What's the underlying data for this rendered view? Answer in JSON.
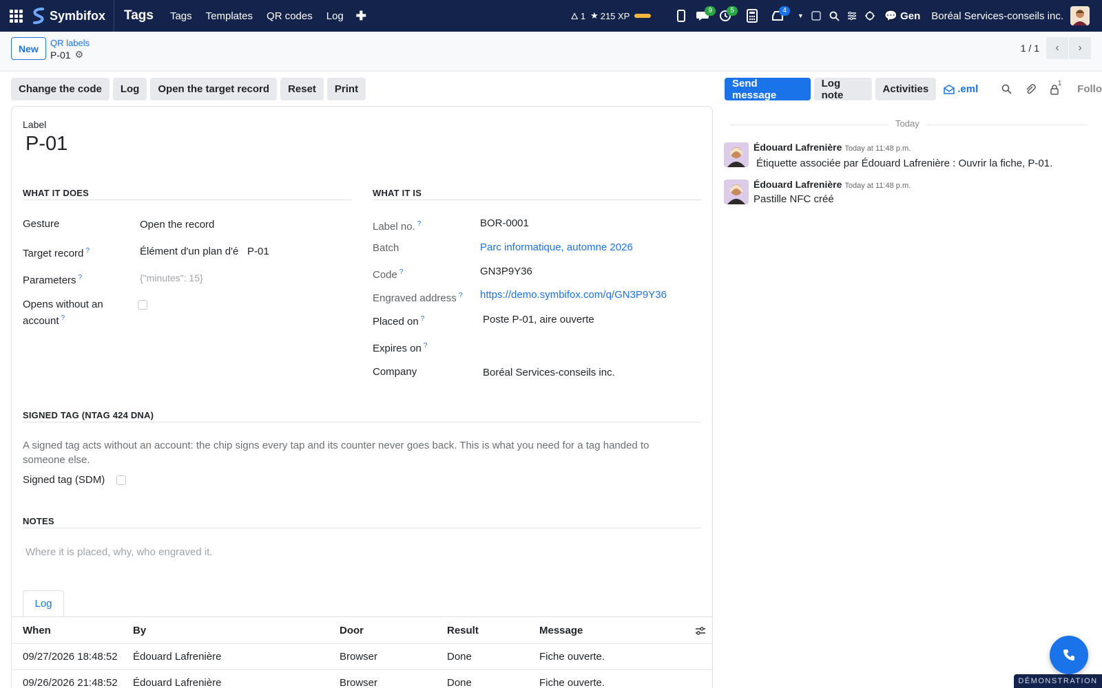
{
  "nav": {
    "brand": "Symbifox",
    "app_title": "Tags",
    "menu": [
      "Tags",
      "Templates",
      "QR codes",
      "Log"
    ],
    "streak": "1",
    "xp": "215 XP",
    "badges": {
      "messages": "9",
      "activities": "5",
      "inbox": "4"
    },
    "gen_label": "Gen",
    "company": "Boréal Services-conseils inc."
  },
  "control": {
    "new_label": "New",
    "breadcrumb_parent": "QR labels",
    "breadcrumb_current": "P-01",
    "pager": "1 / 1"
  },
  "status_buttons": [
    "Change the code",
    "Log",
    "Open the target record",
    "Reset",
    "Print"
  ],
  "form": {
    "label_caption": "Label",
    "label_value": "P-01",
    "what_it_does": {
      "title": "WHAT IT DOES",
      "gesture_label": "Gesture",
      "gesture_value": "Open the record",
      "target_label": "Target record",
      "target_model": "Élément d'un plan d'é",
      "target_value": "P-01",
      "params_label": "Parameters",
      "params_placeholder": "{\"minutes\": 15}",
      "opens_label": "Opens without an account"
    },
    "what_it_is": {
      "title": "WHAT IT IS",
      "label_no_label": "Label no.",
      "label_no_value": "BOR-0001",
      "batch_label": "Batch",
      "batch_value": "Parc informatique, automne 2026",
      "code_label": "Code",
      "code_value": "GN3P9Y36",
      "address_label": "Engraved address",
      "address_value": "https://demo.symbifox.com/q/GN3P9Y36",
      "placed_label": "Placed on",
      "placed_value": "Poste P-01, aire ouverte",
      "expires_label": "Expires on",
      "company_label": "Company",
      "company_value": "Boréal Services-conseils inc."
    },
    "signed": {
      "title": "SIGNED TAG (NTAG 424 DNA)",
      "description": "A signed tag acts without an account: the chip signs every tap and its counter never goes back. This is what you need for a tag handed to someone else.",
      "sdm_label": "Signed tag (SDM)"
    },
    "notes": {
      "title": "NOTES",
      "placeholder": "Where it is placed, why, who engraved it."
    },
    "tab_label": "Log",
    "log": {
      "headers": [
        "When",
        "By",
        "Door",
        "Result",
        "Message"
      ],
      "rows": [
        [
          "09/27/2026 18:48:52",
          "Édouard Lafrenière",
          "Browser",
          "Done",
          "Fiche ouverte."
        ],
        [
          "09/26/2026 21:48:52",
          "Édouard Lafrenière",
          "Browser",
          "Done",
          "Fiche ouverte."
        ]
      ]
    }
  },
  "chatter": {
    "send_message": "Send message",
    "log_note": "Log note",
    "activities": "Activities",
    "eml": ".eml",
    "followers_count": "1",
    "follow": "Follo",
    "today": "Today",
    "messages": [
      {
        "author": "Édouard Lafrenière",
        "time": "Today at 11:48 p.m.",
        "body": "Étiquette associée par Édouard Lafrenière : Ouvrir la fiche, P-01."
      },
      {
        "author": "Édouard Lafrenière",
        "time": "Today at 11:48 p.m.",
        "body": "Pastille NFC créé"
      }
    ]
  },
  "demo_label": "DÉMONSTRATION",
  "colors": {
    "navbar": "#14234b",
    "primary": "#1a73e8",
    "badge_green": "#28a745",
    "xp_bar": "#f5b63d"
  }
}
